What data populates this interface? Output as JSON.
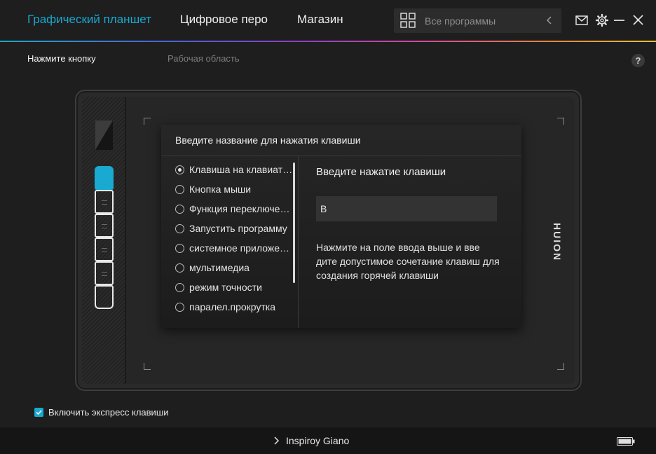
{
  "header": {
    "tabs": [
      {
        "label": "Графический планшет",
        "active": true
      },
      {
        "label": "Цифровое перо",
        "active": false
      },
      {
        "label": "Магазин",
        "active": false
      }
    ],
    "search": {
      "placeholder": "Все программы"
    }
  },
  "subtabs": [
    {
      "label": "Нажмите кнопку",
      "active": true
    },
    {
      "label": "Рабочая область",
      "active": false
    }
  ],
  "help_label": "?",
  "tablet": {
    "brand": "HUION",
    "express_keys_count": 6,
    "selected_key_index": 0
  },
  "dialog": {
    "title": "Введите название для нажатия клавиши",
    "options": [
      {
        "label": "Клавиша на клавиатуре",
        "checked": true
      },
      {
        "label": "Кнопка мыши",
        "checked": false
      },
      {
        "label": "Функция переключения",
        "checked": false
      },
      {
        "label": "Запустить программу",
        "checked": false
      },
      {
        "label": "системное приложение",
        "checked": false
      },
      {
        "label": "мультимедиа",
        "checked": false
      },
      {
        "label": "режим точности",
        "checked": false
      },
      {
        "label": "паралел.прокрутка",
        "checked": false
      }
    ],
    "right_heading": "Введите нажатие клавиши",
    "key_value": "B",
    "hint": "Нажмите на поле ввода выше и вве дите допустимое сочетание клавиш для создания горячей клавиши"
  },
  "express_keys_toggle": {
    "label": "Включить экспресс клавиши",
    "checked": true
  },
  "footer": {
    "device_name": "Inspiroy Giano"
  },
  "colors": {
    "accent": "#19a9d1",
    "background": "#1e1e1e",
    "footer": "#151515"
  }
}
